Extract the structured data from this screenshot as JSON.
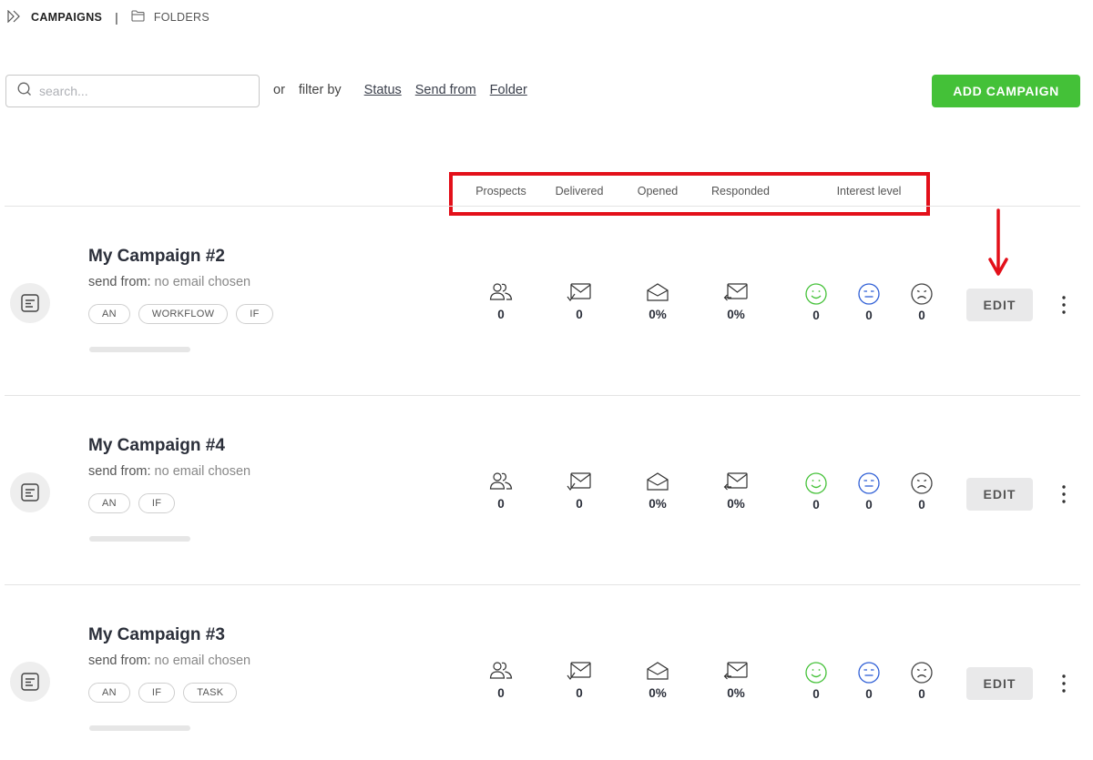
{
  "nav": {
    "campaigns_label": "CAMPAIGNS",
    "separator": "|",
    "folders_label": "FOLDERS"
  },
  "search": {
    "placeholder": "search..."
  },
  "filter": {
    "or_label": "or",
    "filter_by_label": "filter by",
    "links": [
      "Status",
      "Send from",
      "Folder"
    ]
  },
  "add_campaign_label": "ADD CAMPAIGN",
  "columns": [
    "Prospects",
    "Delivered",
    "Opened",
    "Responded",
    "Interest level"
  ],
  "annotation_color": "#e3101a",
  "colors": {
    "accent": "#44c138",
    "positive": "#44c138",
    "neutral": "#2f5fd6",
    "negative": "#444444"
  },
  "campaigns": [
    {
      "title": "My Campaign #2",
      "send_from_label": "send from:",
      "send_from_value": "no email chosen",
      "tags": [
        "AN",
        "WORKFLOW",
        "IF"
      ],
      "prospects": "0",
      "delivered": "0",
      "opened": "0%",
      "responded": "0%",
      "interest_positive": "0",
      "interest_neutral": "0",
      "interest_negative": "0",
      "edit_label": "EDIT"
    },
    {
      "title": "My Campaign #4",
      "send_from_label": "send from:",
      "send_from_value": "no email chosen",
      "tags": [
        "AN",
        "IF"
      ],
      "prospects": "0",
      "delivered": "0",
      "opened": "0%",
      "responded": "0%",
      "interest_positive": "0",
      "interest_neutral": "0",
      "interest_negative": "0",
      "edit_label": "EDIT"
    },
    {
      "title": "My Campaign #3",
      "send_from_label": "send from:",
      "send_from_value": "no email chosen",
      "tags": [
        "AN",
        "IF",
        "TASK"
      ],
      "prospects": "0",
      "delivered": "0",
      "opened": "0%",
      "responded": "0%",
      "interest_positive": "0",
      "interest_neutral": "0",
      "interest_negative": "0",
      "edit_label": "EDIT"
    }
  ]
}
